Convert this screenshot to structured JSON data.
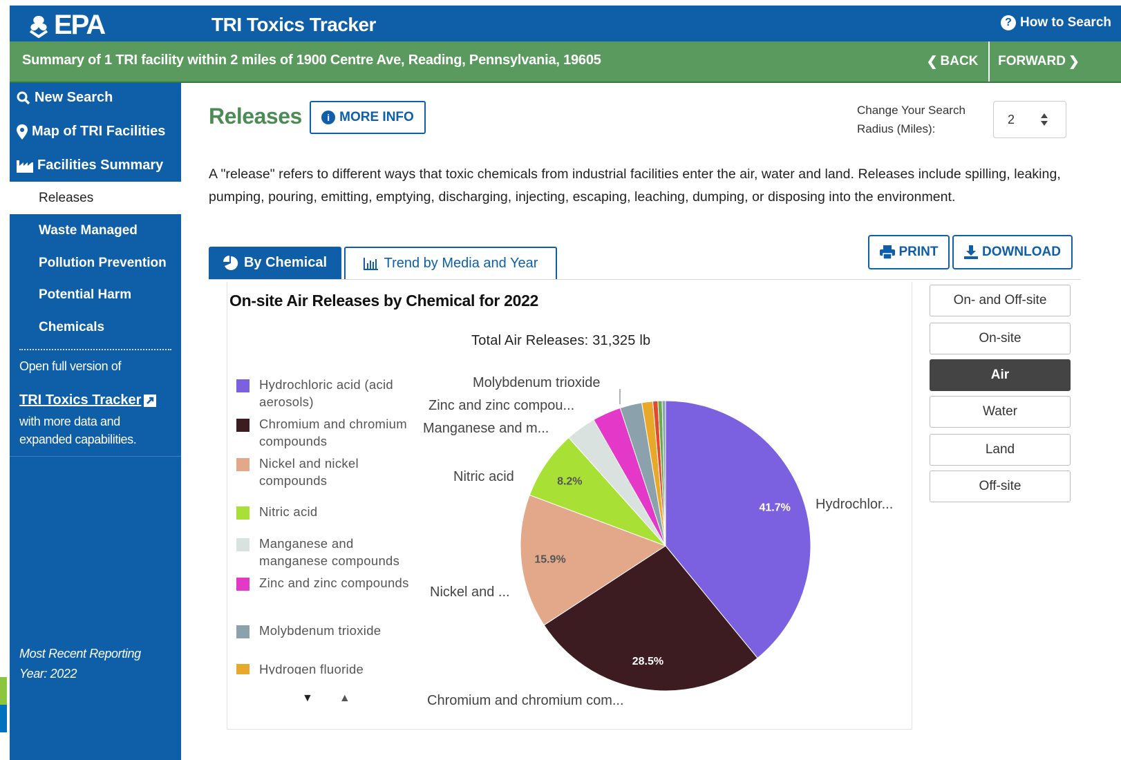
{
  "header": {
    "logo_text": "EPA",
    "app_title": "TRI Toxics Tracker",
    "how_to_search": "How to Search"
  },
  "summary": {
    "text": "Summary of 1 TRI facility within 2 miles of 1900 Centre Ave, Reading, Pennsylvania, 19605",
    "back_label": "BACK",
    "forward_label": "FORWARD"
  },
  "sidebar": {
    "new_search": "New Search",
    "map": "Map of TRI Facilities",
    "facilities_summary": "Facilities Summary",
    "items": [
      {
        "label": "Releases",
        "active": true
      },
      {
        "label": "Waste Managed",
        "active": false
      },
      {
        "label": "Pollution Prevention",
        "active": false
      },
      {
        "label": "Potential Harm",
        "active": false
      },
      {
        "label": "Chemicals",
        "active": false
      }
    ],
    "open_full_version": "Open full version of",
    "tracker_link": "TRI Toxics Tracker",
    "more_data_line1": "with more data and",
    "more_data_line2": "expanded capabilities.",
    "recent_year_line1": "Most Recent Reporting",
    "recent_year_line2": "Year: 2022"
  },
  "main": {
    "title": "Releases",
    "more_info": "MORE INFO",
    "radius_label_line1": "Change Your Search",
    "radius_label_line2": "Radius (Miles):",
    "radius_value": "2",
    "description": "A \"release\" refers to different ways that toxic chemicals from industrial facilities enter the air, water and land. Releases include spilling, leaking, pumping, pouring, emitting, emptying, discharging, injecting, escaping, leaching, dumping, or disposing into the environment.",
    "tabs": [
      {
        "label": "By Chemical",
        "active": true
      },
      {
        "label": "Trend by Media and Year",
        "active": false
      }
    ],
    "print": "PRINT",
    "download": "DOWNLOAD",
    "media_buttons": [
      {
        "label": "On- and Off-site",
        "active": false
      },
      {
        "label": "On-site",
        "active": false
      },
      {
        "label": "Air",
        "active": true
      },
      {
        "label": "Water",
        "active": false
      },
      {
        "label": "Land",
        "active": false
      },
      {
        "label": "Off-site",
        "active": false
      }
    ]
  },
  "chart_data": {
    "type": "pie",
    "title": "On-site Air Releases by Chemical for 2022",
    "subtitle": "Total Air Releases: 31,325 lb",
    "legend_position": "left",
    "slices": [
      {
        "name": "Hydrochloric acid (acid aerosols)",
        "value": 41.7,
        "color": "#7b61e0",
        "pct_label": "41.7%",
        "outer_label": "Hydrochlor..."
      },
      {
        "name": "Chromium and chromium compounds",
        "value": 28.5,
        "color": "#3d1c21",
        "pct_label": "28.5%",
        "outer_label": "Chromium and chromium com..."
      },
      {
        "name": "Nickel and nickel compounds",
        "value": 15.9,
        "color": "#e3a88a",
        "pct_label": "15.9%",
        "outer_label": "Nickel and ..."
      },
      {
        "name": "Nitric acid",
        "value": 8.2,
        "color": "#a8e035",
        "pct_label": "8.2%",
        "outer_label": "Nitric acid"
      },
      {
        "name": "Manganese and manganese compounds",
        "value": 3.6,
        "color": "#d9e2df",
        "pct_label": "",
        "outer_label": "Manganese and m..."
      },
      {
        "name": "Zinc and zinc compounds",
        "value": 3.4,
        "color": "#e438c8",
        "pct_label": "",
        "outer_label": "Zinc and zinc compou..."
      },
      {
        "name": "Molybdenum trioxide",
        "value": 2.6,
        "color": "#8ba2ad",
        "pct_label": "",
        "outer_label": "Molybdenum trioxide"
      },
      {
        "name": "Hydrogen fluoride",
        "value": 1.3,
        "color": "#e8a92a",
        "pct_label": "",
        "outer_label": ""
      },
      {
        "name": "",
        "value": 0.6,
        "color": "#e2492d",
        "pct_label": "",
        "outer_label": ""
      },
      {
        "name": "",
        "value": 0.5,
        "color": "#6aa84f",
        "pct_label": "",
        "outer_label": ""
      },
      {
        "name": "",
        "value": 0.4,
        "color": "#8aa5ae",
        "pct_label": "",
        "outer_label": ""
      }
    ]
  }
}
